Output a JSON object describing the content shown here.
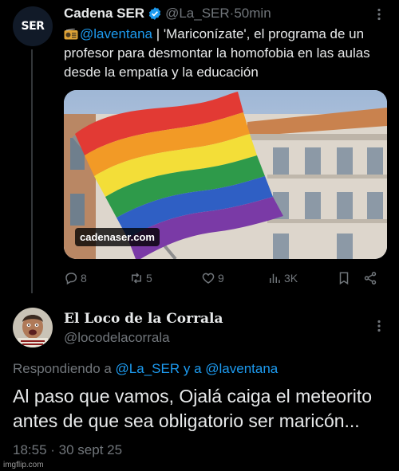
{
  "tweet": {
    "author_name": "Cadena SER",
    "avatar_text": "SER",
    "handle": "@La_SER",
    "separator": " · ",
    "time_ago": "50min",
    "mention": "@laventana",
    "text": " | 'Mariconízate', el programa de un profesor para desmontar la homofobia en las aulas desde la empatía y la educación",
    "media_source": "cadenaser.com",
    "actions": {
      "replies": "8",
      "reposts": "5",
      "likes": "9",
      "views": "3K"
    }
  },
  "reply": {
    "author_name": "El Loco de la Corrala",
    "handle": "@locodelacorrala",
    "replying_prefix": "Respondiendo a ",
    "replying_user1": "@La_SER",
    "replying_join": " y a ",
    "replying_user2": "@laventana",
    "text": "Al paso que vamos, Ojalá caiga el meteorito antes de que sea obligatorio ser maricón...",
    "time": "18:55",
    "separator": " · ",
    "date": "30 sept 25"
  },
  "watermark": "imgflip.com",
  "colors": {
    "background": "#000000",
    "text": "#e7e9ea",
    "muted": "#71767b",
    "accent": "#1d9bf0"
  },
  "icons": [
    "radio-icon",
    "verified-icon",
    "more-icon",
    "reply-icon",
    "repost-icon",
    "like-icon",
    "views-icon",
    "bookmark-icon",
    "share-icon"
  ]
}
